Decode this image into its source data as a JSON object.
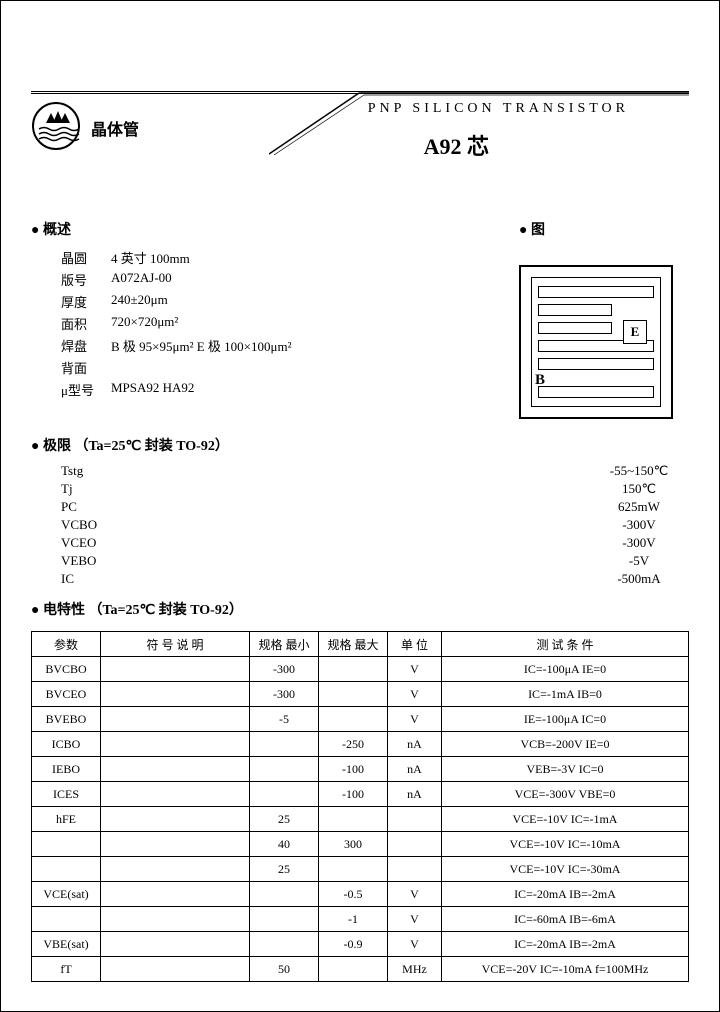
{
  "header": {
    "subtitle": "PNP  SILICON  TRANSISTOR",
    "part": "A92",
    "part_suffix": "芯",
    "logo_text": "晶体管"
  },
  "sec_general": {
    "title": "● 概述",
    "lines": [
      {
        "label": "晶圆",
        "value": "4 英寸  100mm"
      },
      {
        "label": "版号",
        "value": "A072AJ-00"
      },
      {
        "label": "厚度",
        "value": "240±20μm"
      },
      {
        "label": "面积",
        "value": "720×720μm²"
      },
      {
        "label": "焊盘",
        "value": "B 极 95×95μm²  E 极 100×100μm²"
      },
      {
        "label": "背面",
        "value": ""
      },
      {
        "label": "μ型号",
        "value": "MPSA92  HA92"
      }
    ]
  },
  "sec_diagram": {
    "title": "● 图",
    "label_e": "E",
    "label_b": "B"
  },
  "sec_ratings": {
    "title": "● 极限  （Ta=25℃ 封装  TO-92）",
    "rows": [
      {
        "sym": "Tstg",
        "desc": "",
        "val": "-55~150℃"
      },
      {
        "sym": "Tj",
        "desc": "",
        "val": "150℃"
      },
      {
        "sym": "PC",
        "desc": "",
        "val": "625mW"
      },
      {
        "sym": "VCBO",
        "desc": "",
        "val": "-300V"
      },
      {
        "sym": "VCEO",
        "desc": "",
        "val": "-300V"
      },
      {
        "sym": "VEBO",
        "desc": "",
        "val": "-5V"
      },
      {
        "sym": "IC",
        "desc": "",
        "val": "-500mA"
      }
    ]
  },
  "sec_elec": {
    "title": "● 电特性 （Ta=25℃ 封装  TO-92）",
    "headers": [
      "参数",
      "符 号 说 明",
      "规格 最小",
      "规格 最大",
      "单 位",
      "测 试 条 件"
    ],
    "rows": [
      {
        "p": "BVCBO",
        "d": "",
        "min": "-300",
        "max": "",
        "u": "V",
        "c": "IC=-100μA  IE=0"
      },
      {
        "p": "BVCEO",
        "d": "",
        "min": "-300",
        "max": "",
        "u": "V",
        "c": "IC=-1mA  IB=0"
      },
      {
        "p": "BVEBO",
        "d": "",
        "min": "-5",
        "max": "",
        "u": "V",
        "c": "IE=-100μA  IC=0"
      },
      {
        "p": "ICBO",
        "d": "",
        "min": "",
        "max": "-250",
        "u": "nA",
        "c": "VCB=-200V  IE=0"
      },
      {
        "p": "IEBO",
        "d": "",
        "min": "",
        "max": "-100",
        "u": "nA",
        "c": "VEB=-3V  IC=0"
      },
      {
        "p": "ICES",
        "d": "",
        "min": "",
        "max": "-100",
        "u": "nA",
        "c": "VCE=-300V  VBE=0"
      },
      {
        "p": "hFE",
        "d": "",
        "min": "25",
        "max": "",
        "u": "",
        "c": "VCE=-10V  IC=-1mA"
      },
      {
        "p": "",
        "d": "",
        "min": "40",
        "max": "300",
        "u": "",
        "c": "VCE=-10V  IC=-10mA"
      },
      {
        "p": "",
        "d": "",
        "min": "25",
        "max": "",
        "u": "",
        "c": "VCE=-10V  IC=-30mA"
      },
      {
        "p": "VCE(sat)",
        "d": "",
        "min": "",
        "max": "-0.5",
        "u": "V",
        "c": "IC=-20mA  IB=-2mA"
      },
      {
        "p": "",
        "d": "",
        "min": "",
        "max": "-1",
        "u": "V",
        "c": "IC=-60mA  IB=-6mA"
      },
      {
        "p": "VBE(sat)",
        "d": "",
        "min": "",
        "max": "-0.9",
        "u": "V",
        "c": "IC=-20mA  IB=-2mA"
      },
      {
        "p": "fT",
        "d": "",
        "min": "50",
        "max": "",
        "u": "MHz",
        "c": "VCE=-20V  IC=-10mA f=100MHz"
      }
    ]
  }
}
